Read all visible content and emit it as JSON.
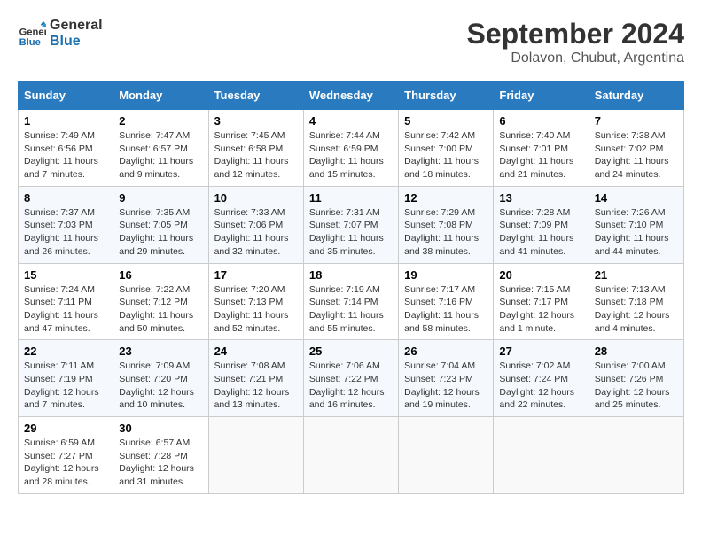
{
  "logo": {
    "line1": "General",
    "line2": "Blue"
  },
  "title": "September 2024",
  "subtitle": "Dolavon, Chubut, Argentina",
  "weekdays": [
    "Sunday",
    "Monday",
    "Tuesday",
    "Wednesday",
    "Thursday",
    "Friday",
    "Saturday"
  ],
  "weeks": [
    [
      {
        "day": "1",
        "sunrise": "7:49 AM",
        "sunset": "6:56 PM",
        "daylight": "11 hours and 7 minutes."
      },
      {
        "day": "2",
        "sunrise": "7:47 AM",
        "sunset": "6:57 PM",
        "daylight": "11 hours and 9 minutes."
      },
      {
        "day": "3",
        "sunrise": "7:45 AM",
        "sunset": "6:58 PM",
        "daylight": "11 hours and 12 minutes."
      },
      {
        "day": "4",
        "sunrise": "7:44 AM",
        "sunset": "6:59 PM",
        "daylight": "11 hours and 15 minutes."
      },
      {
        "day": "5",
        "sunrise": "7:42 AM",
        "sunset": "7:00 PM",
        "daylight": "11 hours and 18 minutes."
      },
      {
        "day": "6",
        "sunrise": "7:40 AM",
        "sunset": "7:01 PM",
        "daylight": "11 hours and 21 minutes."
      },
      {
        "day": "7",
        "sunrise": "7:38 AM",
        "sunset": "7:02 PM",
        "daylight": "11 hours and 24 minutes."
      }
    ],
    [
      {
        "day": "8",
        "sunrise": "7:37 AM",
        "sunset": "7:03 PM",
        "daylight": "11 hours and 26 minutes."
      },
      {
        "day": "9",
        "sunrise": "7:35 AM",
        "sunset": "7:05 PM",
        "daylight": "11 hours and 29 minutes."
      },
      {
        "day": "10",
        "sunrise": "7:33 AM",
        "sunset": "7:06 PM",
        "daylight": "11 hours and 32 minutes."
      },
      {
        "day": "11",
        "sunrise": "7:31 AM",
        "sunset": "7:07 PM",
        "daylight": "11 hours and 35 minutes."
      },
      {
        "day": "12",
        "sunrise": "7:29 AM",
        "sunset": "7:08 PM",
        "daylight": "11 hours and 38 minutes."
      },
      {
        "day": "13",
        "sunrise": "7:28 AM",
        "sunset": "7:09 PM",
        "daylight": "11 hours and 41 minutes."
      },
      {
        "day": "14",
        "sunrise": "7:26 AM",
        "sunset": "7:10 PM",
        "daylight": "11 hours and 44 minutes."
      }
    ],
    [
      {
        "day": "15",
        "sunrise": "7:24 AM",
        "sunset": "7:11 PM",
        "daylight": "11 hours and 47 minutes."
      },
      {
        "day": "16",
        "sunrise": "7:22 AM",
        "sunset": "7:12 PM",
        "daylight": "11 hours and 50 minutes."
      },
      {
        "day": "17",
        "sunrise": "7:20 AM",
        "sunset": "7:13 PM",
        "daylight": "11 hours and 52 minutes."
      },
      {
        "day": "18",
        "sunrise": "7:19 AM",
        "sunset": "7:14 PM",
        "daylight": "11 hours and 55 minutes."
      },
      {
        "day": "19",
        "sunrise": "7:17 AM",
        "sunset": "7:16 PM",
        "daylight": "11 hours and 58 minutes."
      },
      {
        "day": "20",
        "sunrise": "7:15 AM",
        "sunset": "7:17 PM",
        "daylight": "12 hours and 1 minute."
      },
      {
        "day": "21",
        "sunrise": "7:13 AM",
        "sunset": "7:18 PM",
        "daylight": "12 hours and 4 minutes."
      }
    ],
    [
      {
        "day": "22",
        "sunrise": "7:11 AM",
        "sunset": "7:19 PM",
        "daylight": "12 hours and 7 minutes."
      },
      {
        "day": "23",
        "sunrise": "7:09 AM",
        "sunset": "7:20 PM",
        "daylight": "12 hours and 10 minutes."
      },
      {
        "day": "24",
        "sunrise": "7:08 AM",
        "sunset": "7:21 PM",
        "daylight": "12 hours and 13 minutes."
      },
      {
        "day": "25",
        "sunrise": "7:06 AM",
        "sunset": "7:22 PM",
        "daylight": "12 hours and 16 minutes."
      },
      {
        "day": "26",
        "sunrise": "7:04 AM",
        "sunset": "7:23 PM",
        "daylight": "12 hours and 19 minutes."
      },
      {
        "day": "27",
        "sunrise": "7:02 AM",
        "sunset": "7:24 PM",
        "daylight": "12 hours and 22 minutes."
      },
      {
        "day": "28",
        "sunrise": "7:00 AM",
        "sunset": "7:26 PM",
        "daylight": "12 hours and 25 minutes."
      }
    ],
    [
      {
        "day": "29",
        "sunrise": "6:59 AM",
        "sunset": "7:27 PM",
        "daylight": "12 hours and 28 minutes."
      },
      {
        "day": "30",
        "sunrise": "6:57 AM",
        "sunset": "7:28 PM",
        "daylight": "12 hours and 31 minutes."
      },
      null,
      null,
      null,
      null,
      null
    ]
  ],
  "labels": {
    "sunrise": "Sunrise:",
    "sunset": "Sunset:",
    "daylight": "Daylight:"
  }
}
